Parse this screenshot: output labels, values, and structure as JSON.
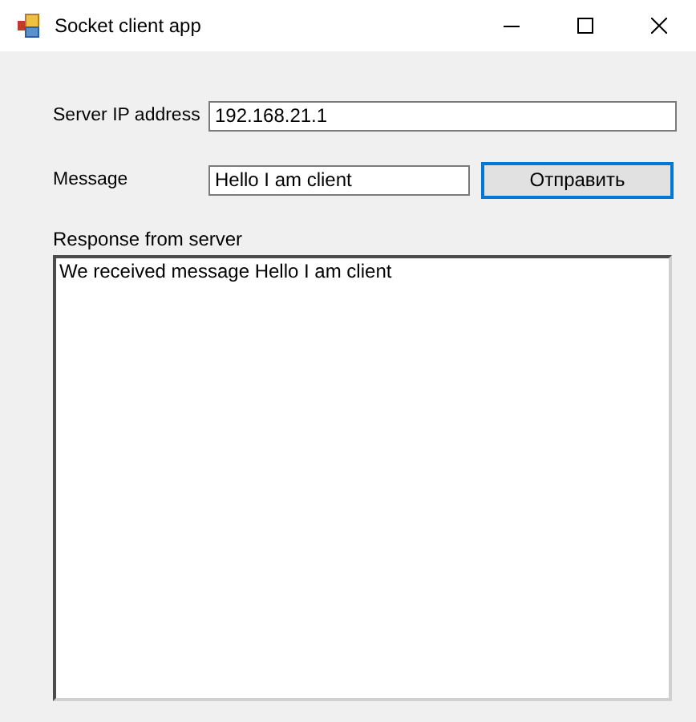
{
  "window": {
    "title": "Socket client app"
  },
  "server_ip": {
    "label": "Server IP address",
    "value": "192.168.21.1"
  },
  "message": {
    "label": "Message",
    "value": "Hello I am client"
  },
  "send_button": {
    "label": "Отправить",
    "focused": true
  },
  "response": {
    "label": "Response from server",
    "value": "We received message Hello I am client"
  }
}
